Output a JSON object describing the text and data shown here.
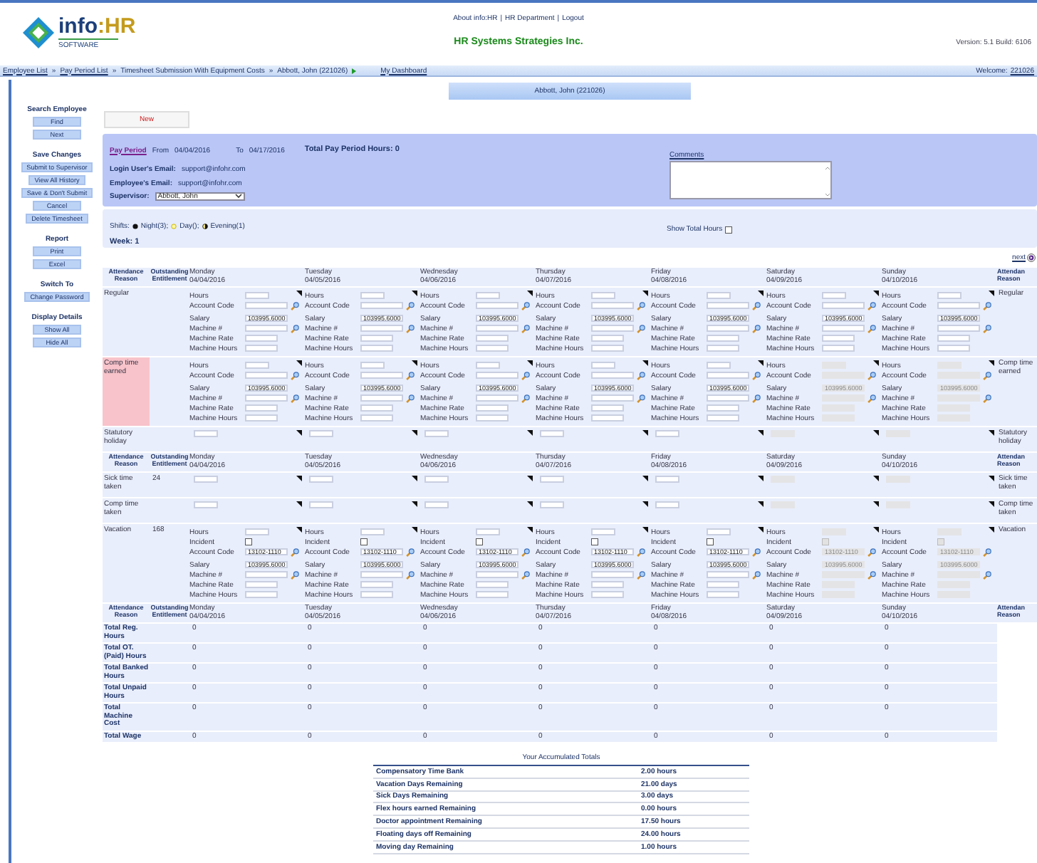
{
  "header": {
    "logo": {
      "brand": "info",
      "brand_accent": ":HR",
      "tagline": "SOFTWARE"
    },
    "links": [
      "About info:HR",
      "HR Department",
      "Logout"
    ],
    "link_separator": "|",
    "company": "HR Systems Strategies Inc.",
    "version": "Version: 5.1 Build: 6106"
  },
  "breadcrumb": {
    "items": [
      {
        "label": "Employee List",
        "link": true
      },
      {
        "label": "Pay Period List",
        "link": true
      },
      {
        "label": "Timesheet Submission With Equipment Costs",
        "link": false
      },
      {
        "label": "Abbott, John (221026)",
        "link": false
      }
    ],
    "separator": "»",
    "dashboard": "My Dashboard",
    "welcome": "Welcome:",
    "user": "221026"
  },
  "sidebar": {
    "groups": [
      {
        "title": "Search Employee",
        "buttons": [
          "Find",
          "Next"
        ]
      },
      {
        "title": "Save Changes",
        "buttons": [
          "Submit to Supervisor",
          "View All History",
          "Save & Don't Submit",
          "Cancel",
          "Delete Timesheet"
        ]
      },
      {
        "title": "Report",
        "buttons": [
          "Print",
          "Excel"
        ]
      },
      {
        "title": "Switch To",
        "buttons": [
          "Change Password"
        ]
      },
      {
        "title": "Display Details",
        "buttons": [
          "Show All",
          "Hide All"
        ]
      }
    ]
  },
  "employee_title": "Abbott, John (221026)",
  "new_button": "New",
  "pay_period": {
    "link": "Pay Period",
    "from_label": "From",
    "from": "04/04/2016",
    "to_label": "To",
    "to": "04/17/2016",
    "total": "Total Pay Period Hours: 0",
    "login_email_label": "Login User's Email:",
    "login_email": "support@infohr.com",
    "employee_email_label": "Employee's Email:",
    "employee_email": "support@infohr.com",
    "supervisor_label": "Supervisor:",
    "supervisor": "Abbott, John",
    "comments_label": "Comments"
  },
  "shifts": {
    "label": "Shifts:",
    "items": [
      {
        "kind": "night",
        "label": "Night(3);"
      },
      {
        "kind": "day",
        "label": "Day();"
      },
      {
        "kind": "evening",
        "label": "Evening(1)"
      }
    ]
  },
  "show_total_hours": {
    "label": "Show Total Hours",
    "checked": false
  },
  "week": "Week: 1",
  "next_link": "next",
  "sections": [
    {
      "header": {
        "reason": "Attendance Reason",
        "entitlement": "Outstanding Entitlement",
        "right": "Attendan Reason"
      },
      "days": [
        {
          "name": "Monday",
          "date": "04/04/2016"
        },
        {
          "name": "Tuesday",
          "date": "04/05/2016"
        },
        {
          "name": "Wednesday",
          "date": "04/06/2016"
        },
        {
          "name": "Thursday",
          "date": "04/07/2016"
        },
        {
          "name": "Friday",
          "date": "04/08/2016"
        },
        {
          "name": "Saturday",
          "date": "04/09/2016"
        },
        {
          "name": "Sunday",
          "date": "04/10/2016"
        }
      ],
      "rows": [
        {
          "kind": "detail",
          "reason": "Regular",
          "right_reason": "Regular",
          "highlighted": false,
          "cells": [
            {
              "disabled": false,
              "fields": [
                {
                  "kind": "hours",
                  "label": "Hours"
                },
                {
                  "kind": "account",
                  "label": "Account Code"
                },
                {
                  "kind": "salary",
                  "label": "Salary",
                  "value": "103995.6000"
                },
                {
                  "kind": "machine",
                  "label": "Machine #"
                },
                {
                  "kind": "rate",
                  "label": "Machine Rate"
                },
                {
                  "kind": "machine_hours",
                  "label": "Machine Hours"
                }
              ]
            },
            {
              "disabled": false,
              "fields": [
                {
                  "kind": "hours",
                  "label": "Hours"
                },
                {
                  "kind": "account",
                  "label": "Account Code"
                },
                {
                  "kind": "salary",
                  "label": "Salary",
                  "value": "103995.6000"
                },
                {
                  "kind": "machine",
                  "label": "Machine #"
                },
                {
                  "kind": "rate",
                  "label": "Machine Rate"
                },
                {
                  "kind": "machine_hours",
                  "label": "Machine Hours"
                }
              ]
            },
            {
              "disabled": false,
              "fields": [
                {
                  "kind": "hours",
                  "label": "Hours"
                },
                {
                  "kind": "account",
                  "label": "Account Code"
                },
                {
                  "kind": "salary",
                  "label": "Salary",
                  "value": "103995.6000"
                },
                {
                  "kind": "machine",
                  "label": "Machine #"
                },
                {
                  "kind": "rate",
                  "label": "Machine Rate"
                },
                {
                  "kind": "machine_hours",
                  "label": "Machine Hours"
                }
              ]
            },
            {
              "disabled": false,
              "fields": [
                {
                  "kind": "hours",
                  "label": "Hours"
                },
                {
                  "kind": "account",
                  "label": "Account Code"
                },
                {
                  "kind": "salary",
                  "label": "Salary",
                  "value": "103995.6000"
                },
                {
                  "kind": "machine",
                  "label": "Machine #"
                },
                {
                  "kind": "rate",
                  "label": "Machine Rate"
                },
                {
                  "kind": "machine_hours",
                  "label": "Machine Hours"
                }
              ]
            },
            {
              "disabled": false,
              "fields": [
                {
                  "kind": "hours",
                  "label": "Hours"
                },
                {
                  "kind": "account",
                  "label": "Account Code"
                },
                {
                  "kind": "salary",
                  "label": "Salary",
                  "value": "103995.6000"
                },
                {
                  "kind": "machine",
                  "label": "Machine #"
                },
                {
                  "kind": "rate",
                  "label": "Machine Rate"
                },
                {
                  "kind": "machine_hours",
                  "label": "Machine Hours"
                }
              ]
            },
            {
              "disabled": false,
              "fields": [
                {
                  "kind": "hours",
                  "label": "Hours"
                },
                {
                  "kind": "account",
                  "label": "Account Code"
                },
                {
                  "kind": "salary",
                  "label": "Salary",
                  "value": "103995.6000"
                },
                {
                  "kind": "machine",
                  "label": "Machine #"
                },
                {
                  "kind": "rate",
                  "label": "Machine Rate"
                },
                {
                  "kind": "machine_hours",
                  "label": "Machine Hours"
                }
              ]
            },
            {
              "disabled": false,
              "fields": [
                {
                  "kind": "hours",
                  "label": "Hours"
                },
                {
                  "kind": "account",
                  "label": "Account Code"
                },
                {
                  "kind": "salary",
                  "label": "Salary",
                  "value": "103995.6000"
                },
                {
                  "kind": "machine",
                  "label": "Machine #"
                },
                {
                  "kind": "rate",
                  "label": "Machine Rate"
                },
                {
                  "kind": "machine_hours",
                  "label": "Machine Hours"
                }
              ]
            }
          ]
        },
        {
          "kind": "detail",
          "reason": "Comp time earned",
          "right_reason": "Comp time earned",
          "highlighted": true,
          "cells": [
            {
              "disabled": false,
              "fields": [
                {
                  "kind": "hours",
                  "label": "Hours"
                },
                {
                  "kind": "account",
                  "label": "Account Code"
                },
                {
                  "kind": "salary",
                  "label": "Salary",
                  "value": "103995.6000"
                },
                {
                  "kind": "machine",
                  "label": "Machine #"
                },
                {
                  "kind": "rate",
                  "label": "Machine Rate"
                },
                {
                  "kind": "machine_hours",
                  "label": "Machine Hours"
                }
              ]
            },
            {
              "disabled": false,
              "fields": [
                {
                  "kind": "hours",
                  "label": "Hours"
                },
                {
                  "kind": "account",
                  "label": "Account Code"
                },
                {
                  "kind": "salary",
                  "label": "Salary",
                  "value": "103995.6000"
                },
                {
                  "kind": "machine",
                  "label": "Machine #"
                },
                {
                  "kind": "rate",
                  "label": "Machine Rate"
                },
                {
                  "kind": "machine_hours",
                  "label": "Machine Hours"
                }
              ]
            },
            {
              "disabled": false,
              "fields": [
                {
                  "kind": "hours",
                  "label": "Hours"
                },
                {
                  "kind": "account",
                  "label": "Account Code"
                },
                {
                  "kind": "salary",
                  "label": "Salary",
                  "value": "103995.6000"
                },
                {
                  "kind": "machine",
                  "label": "Machine #"
                },
                {
                  "kind": "rate",
                  "label": "Machine Rate"
                },
                {
                  "kind": "machine_hours",
                  "label": "Machine Hours"
                }
              ]
            },
            {
              "disabled": false,
              "fields": [
                {
                  "kind": "hours",
                  "label": "Hours"
                },
                {
                  "kind": "account",
                  "label": "Account Code"
                },
                {
                  "kind": "salary",
                  "label": "Salary",
                  "value": "103995.6000"
                },
                {
                  "kind": "machine",
                  "label": "Machine #"
                },
                {
                  "kind": "rate",
                  "label": "Machine Rate"
                },
                {
                  "kind": "machine_hours",
                  "label": "Machine Hours"
                }
              ]
            },
            {
              "disabled": false,
              "fields": [
                {
                  "kind": "hours",
                  "label": "Hours"
                },
                {
                  "kind": "account",
                  "label": "Account Code"
                },
                {
                  "kind": "salary",
                  "label": "Salary",
                  "value": "103995.6000"
                },
                {
                  "kind": "machine",
                  "label": "Machine #"
                },
                {
                  "kind": "rate",
                  "label": "Machine Rate"
                },
                {
                  "kind": "machine_hours",
                  "label": "Machine Hours"
                }
              ]
            },
            {
              "disabled": true,
              "fields": [
                {
                  "kind": "hours",
                  "label": "Hours"
                },
                {
                  "kind": "account",
                  "label": "Account Code"
                },
                {
                  "kind": "salary",
                  "label": "Salary",
                  "value": "103995.6000"
                },
                {
                  "kind": "machine",
                  "label": "Machine #"
                },
                {
                  "kind": "rate",
                  "label": "Machine Rate"
                },
                {
                  "kind": "machine_hours",
                  "label": "Machine Hours"
                }
              ]
            },
            {
              "disabled": true,
              "fields": [
                {
                  "kind": "hours",
                  "label": "Hours"
                },
                {
                  "kind": "account",
                  "label": "Account Code"
                },
                {
                  "kind": "salary",
                  "label": "Salary",
                  "value": "103995.6000"
                },
                {
                  "kind": "machine",
                  "label": "Machine #"
                },
                {
                  "kind": "rate",
                  "label": "Machine Rate"
                },
                {
                  "kind": "machine_hours",
                  "label": "Machine Hours"
                }
              ]
            }
          ]
        },
        {
          "kind": "simple",
          "reason": "Statutory holiday",
          "right_reason": "Statutory holiday",
          "highlighted": false,
          "cells": [
            {
              "disabled": false
            },
            {
              "disabled": false
            },
            {
              "disabled": false
            },
            {
              "disabled": false
            },
            {
              "disabled": false
            },
            {
              "disabled": true
            },
            {
              "disabled": true
            }
          ]
        }
      ]
    },
    {
      "header": {
        "reason": "Attendance Reason",
        "entitlement": "Outstanding Entitlement",
        "right": "Attendan Reason"
      },
      "days": [
        {
          "name": "Monday",
          "date": "04/04/2016"
        },
        {
          "name": "Tuesday",
          "date": "04/05/2016"
        },
        {
          "name": "Wednesday",
          "date": "04/06/2016"
        },
        {
          "name": "Thursday",
          "date": "04/07/2016"
        },
        {
          "name": "Friday",
          "date": "04/08/2016"
        },
        {
          "name": "Saturday",
          "date": "04/09/2016"
        },
        {
          "name": "Sunday",
          "date": "04/10/2016"
        }
      ],
      "rows": [
        {
          "kind": "simple",
          "reason": "Sick time taken",
          "entitlement": "24",
          "right_reason": "Sick time taken",
          "highlighted": false,
          "cells": [
            {
              "disabled": false
            },
            {
              "disabled": false
            },
            {
              "disabled": false
            },
            {
              "disabled": false
            },
            {
              "disabled": false
            },
            {
              "disabled": true
            },
            {
              "disabled": true
            }
          ]
        },
        {
          "kind": "simple",
          "reason": "Comp time taken",
          "right_reason": "Comp time taken",
          "highlighted": false,
          "cells": [
            {
              "disabled": false
            },
            {
              "disabled": false
            },
            {
              "disabled": false
            },
            {
              "disabled": false
            },
            {
              "disabled": false
            },
            {
              "disabled": true
            },
            {
              "disabled": true
            }
          ]
        },
        {
          "kind": "detail",
          "reason": "Vacation",
          "entitlement": "168",
          "right_reason": "Vacation",
          "highlighted": false,
          "cells": [
            {
              "disabled": false,
              "fields": [
                {
                  "kind": "hours",
                  "label": "Hours"
                },
                {
                  "kind": "incident",
                  "label": "Incident",
                  "checked": false
                },
                {
                  "kind": "account",
                  "label": "Account Code",
                  "value": "13102-1110"
                },
                {
                  "kind": "salary",
                  "label": "Salary",
                  "value": "103995.6000"
                },
                {
                  "kind": "machine",
                  "label": "Machine #"
                },
                {
                  "kind": "rate",
                  "label": "Machine Rate"
                },
                {
                  "kind": "machine_hours",
                  "label": "Machine Hours"
                }
              ]
            },
            {
              "disabled": false,
              "fields": [
                {
                  "kind": "hours",
                  "label": "Hours"
                },
                {
                  "kind": "incident",
                  "label": "Incident",
                  "checked": false
                },
                {
                  "kind": "account",
                  "label": "Account Code",
                  "value": "13102-1110"
                },
                {
                  "kind": "salary",
                  "label": "Salary",
                  "value": "103995.6000"
                },
                {
                  "kind": "machine",
                  "label": "Machine #"
                },
                {
                  "kind": "rate",
                  "label": "Machine Rate"
                },
                {
                  "kind": "machine_hours",
                  "label": "Machine Hours"
                }
              ]
            },
            {
              "disabled": false,
              "fields": [
                {
                  "kind": "hours",
                  "label": "Hours"
                },
                {
                  "kind": "incident",
                  "label": "Incident",
                  "checked": false
                },
                {
                  "kind": "account",
                  "label": "Account Code",
                  "value": "13102-1110"
                },
                {
                  "kind": "salary",
                  "label": "Salary",
                  "value": "103995.6000"
                },
                {
                  "kind": "machine",
                  "label": "Machine #"
                },
                {
                  "kind": "rate",
                  "label": "Machine Rate"
                },
                {
                  "kind": "machine_hours",
                  "label": "Machine Hours"
                }
              ]
            },
            {
              "disabled": false,
              "fields": [
                {
                  "kind": "hours",
                  "label": "Hours"
                },
                {
                  "kind": "incident",
                  "label": "Incident",
                  "checked": false
                },
                {
                  "kind": "account",
                  "label": "Account Code",
                  "value": "13102-1110"
                },
                {
                  "kind": "salary",
                  "label": "Salary",
                  "value": "103995.6000"
                },
                {
                  "kind": "machine",
                  "label": "Machine #"
                },
                {
                  "kind": "rate",
                  "label": "Machine Rate"
                },
                {
                  "kind": "machine_hours",
                  "label": "Machine Hours"
                }
              ]
            },
            {
              "disabled": false,
              "fields": [
                {
                  "kind": "hours",
                  "label": "Hours"
                },
                {
                  "kind": "incident",
                  "label": "Incident",
                  "checked": false
                },
                {
                  "kind": "account",
                  "label": "Account Code",
                  "value": "13102-1110"
                },
                {
                  "kind": "salary",
                  "label": "Salary",
                  "value": "103995.6000"
                },
                {
                  "kind": "machine",
                  "label": "Machine #"
                },
                {
                  "kind": "rate",
                  "label": "Machine Rate"
                },
                {
                  "kind": "machine_hours",
                  "label": "Machine Hours"
                }
              ]
            },
            {
              "disabled": true,
              "fields": [
                {
                  "kind": "hours",
                  "label": "Hours"
                },
                {
                  "kind": "incident",
                  "label": "Incident",
                  "checked": false
                },
                {
                  "kind": "account",
                  "label": "Account Code",
                  "value": "13102-1110"
                },
                {
                  "kind": "salary",
                  "label": "Salary",
                  "value": "103995.6000"
                },
                {
                  "kind": "machine",
                  "label": "Machine #"
                },
                {
                  "kind": "rate",
                  "label": "Machine Rate"
                },
                {
                  "kind": "machine_hours",
                  "label": "Machine Hours"
                }
              ]
            },
            {
              "disabled": true,
              "fields": [
                {
                  "kind": "hours",
                  "label": "Hours"
                },
                {
                  "kind": "incident",
                  "label": "Incident",
                  "checked": false
                },
                {
                  "kind": "account",
                  "label": "Account Code",
                  "value": "13102-1110"
                },
                {
                  "kind": "salary",
                  "label": "Salary",
                  "value": "103995.6000"
                },
                {
                  "kind": "machine",
                  "label": "Machine #"
                },
                {
                  "kind": "rate",
                  "label": "Machine Rate"
                },
                {
                  "kind": "machine_hours",
                  "label": "Machine Hours"
                }
              ]
            }
          ]
        }
      ]
    }
  ],
  "totals": {
    "header": {
      "reason": "Attendance Reason",
      "entitlement": "Outstanding Entitlement",
      "right": "Attendan Reason"
    },
    "days": [
      {
        "name": "Monday",
        "date": "04/04/2016"
      },
      {
        "name": "Tuesday",
        "date": "04/05/2016"
      },
      {
        "name": "Wednesday",
        "date": "04/06/2016"
      },
      {
        "name": "Thursday",
        "date": "04/07/2016"
      },
      {
        "name": "Friday",
        "date": "04/08/2016"
      },
      {
        "name": "Saturday",
        "date": "04/09/2016"
      },
      {
        "name": "Sunday",
        "date": "04/10/2016"
      }
    ],
    "rows": [
      {
        "label": "Total Reg. Hours",
        "values": [
          "0",
          "0",
          "0",
          "0",
          "0",
          "0",
          "0"
        ]
      },
      {
        "label": "Total OT. (Paid) Hours",
        "values": [
          "0",
          "0",
          "0",
          "0",
          "0",
          "0",
          "0"
        ]
      },
      {
        "label": "Total Banked Hours",
        "values": [
          "0",
          "0",
          "0",
          "0",
          "0",
          "0",
          "0"
        ]
      },
      {
        "label": "Total Unpaid Hours",
        "values": [
          "0",
          "0",
          "0",
          "0",
          "0",
          "0",
          "0"
        ]
      },
      {
        "label": "Total Machine Cost",
        "values": [
          "0",
          "0",
          "0",
          "0",
          "0",
          "0",
          "0"
        ]
      },
      {
        "label": "Total Wage",
        "values": [
          "0",
          "0",
          "0",
          "0",
          "0",
          "0",
          "0"
        ]
      }
    ]
  },
  "accumulated": {
    "title": "Your Accumulated Totals",
    "rows": [
      {
        "label": "Compensatory Time Bank",
        "value": "2.00 hours"
      },
      {
        "label": "Vacation Days Remaining",
        "value": "21.00 days"
      },
      {
        "label": "Sick Days Remaining",
        "value": "3.00 days"
      },
      {
        "label": "Flex hours earned Remaining",
        "value": "0.00 hours"
      },
      {
        "label": "Doctor appointment Remaining",
        "value": "17.50 hours"
      },
      {
        "label": "Floating days off Remaining",
        "value": "24.00 hours"
      },
      {
        "label": "Moving day Remaining",
        "value": "1.00 hours"
      }
    ]
  }
}
